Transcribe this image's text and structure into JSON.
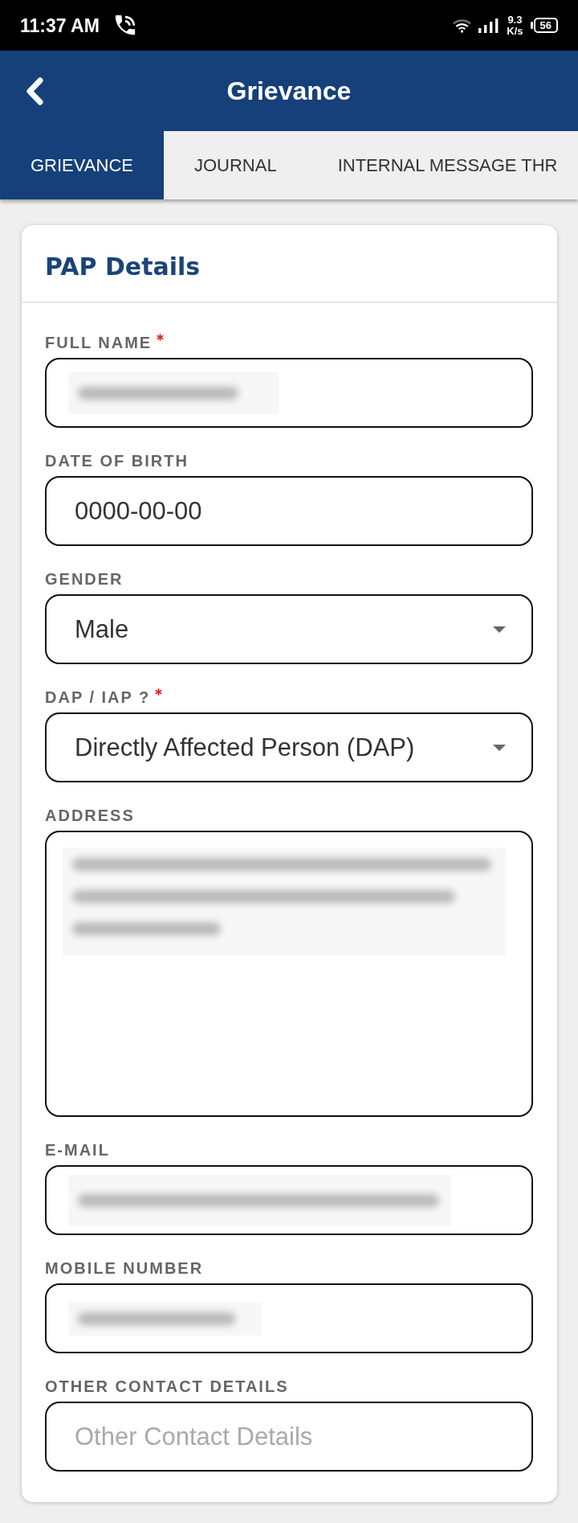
{
  "status_bar": {
    "time": "11:37 AM",
    "network_speed": {
      "value": "9.3",
      "unit": "K/s"
    },
    "battery": "56"
  },
  "header": {
    "title": "Grievance"
  },
  "tabs": [
    {
      "label": "GRIEVANCE",
      "selected": true
    },
    {
      "label": "JOURNAL",
      "selected": false
    },
    {
      "label": "INTERNAL MESSAGE THR",
      "selected": false
    }
  ],
  "card": {
    "title": "PAP Details",
    "fields": [
      {
        "kind": "input",
        "label": "FULL NAME",
        "required": true,
        "blurred": true
      },
      {
        "kind": "input",
        "label": "DATE OF BIRTH",
        "required": false,
        "blurred": false,
        "value": "0000-00-00"
      },
      {
        "kind": "select",
        "label": "GENDER",
        "required": false,
        "blurred": false,
        "value": "Male"
      },
      {
        "kind": "select",
        "label": "DAP / IAP ?",
        "required": true,
        "blurred": false,
        "value": "Directly Affected Person (DAP)"
      },
      {
        "kind": "textarea",
        "label": "ADDRESS",
        "required": false,
        "blurred": true
      },
      {
        "kind": "input",
        "label": "E-MAIL",
        "required": false,
        "blurred": true
      },
      {
        "kind": "input",
        "label": "MOBILE NUMBER",
        "required": false,
        "blurred": true
      },
      {
        "kind": "input",
        "label": "OTHER CONTACT DETAILS",
        "required": false,
        "blurred": false,
        "placeholder": "Other Contact Details"
      }
    ]
  }
}
